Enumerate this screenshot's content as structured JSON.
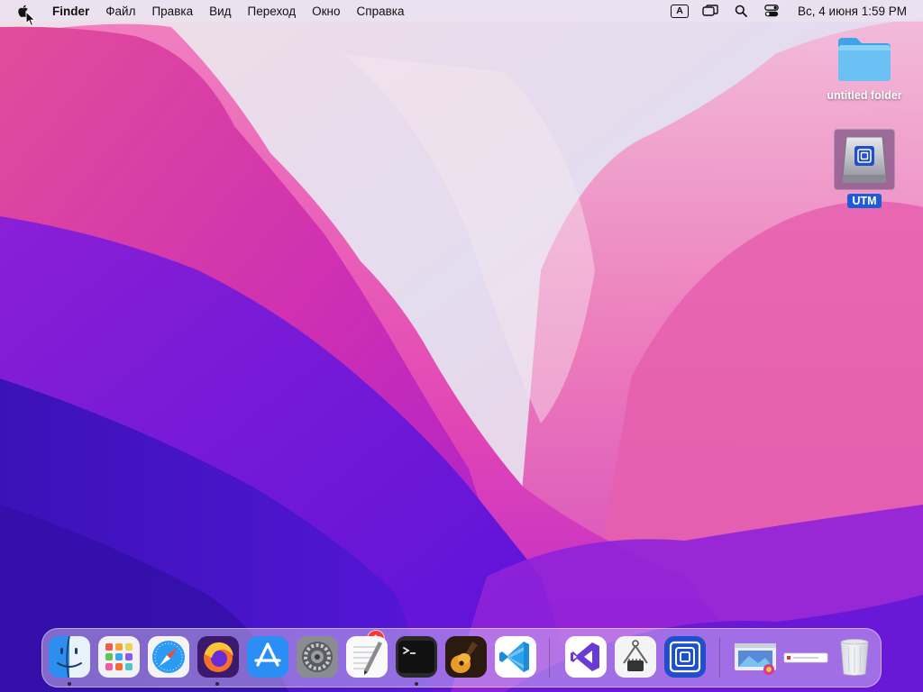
{
  "menubar": {
    "app_name": "Finder",
    "items": [
      "Файл",
      "Правка",
      "Вид",
      "Переход",
      "Окно",
      "Справка"
    ],
    "input_source": "A",
    "clock": "Вс, 4 июня  1:59 PM"
  },
  "desktop": {
    "icons": [
      {
        "label": "untitled folder",
        "selected": false
      },
      {
        "label": "UTM",
        "selected": true
      }
    ]
  },
  "dock": {
    "notification_badge": "1",
    "apps": [
      {
        "icon": "finder-icon",
        "running": true
      },
      {
        "icon": "launchpad-icon",
        "running": false
      },
      {
        "icon": "safari-icon",
        "running": false
      },
      {
        "icon": "firefox-icon",
        "running": true
      },
      {
        "icon": "app-store-icon",
        "running": false
      },
      {
        "icon": "system-preferences-icon",
        "running": false
      },
      {
        "icon": "textedit-icon",
        "running": false
      },
      {
        "icon": "terminal-icon",
        "running": true
      },
      {
        "icon": "garageband-icon",
        "running": false
      },
      {
        "icon": "vscode-icon",
        "running": false
      },
      {
        "icon": "visual-studio-icon",
        "running": false
      },
      {
        "icon": "system-information-icon",
        "running": false
      },
      {
        "icon": "utm-icon",
        "running": false
      }
    ]
  },
  "colors": {
    "accent": "#1e5bd6",
    "badge": "#f23a3a",
    "wallpaper_top": "#e2d8ee",
    "wallpaper_magenta": "#d42a9c",
    "wallpaper_violet": "#5218d0"
  }
}
